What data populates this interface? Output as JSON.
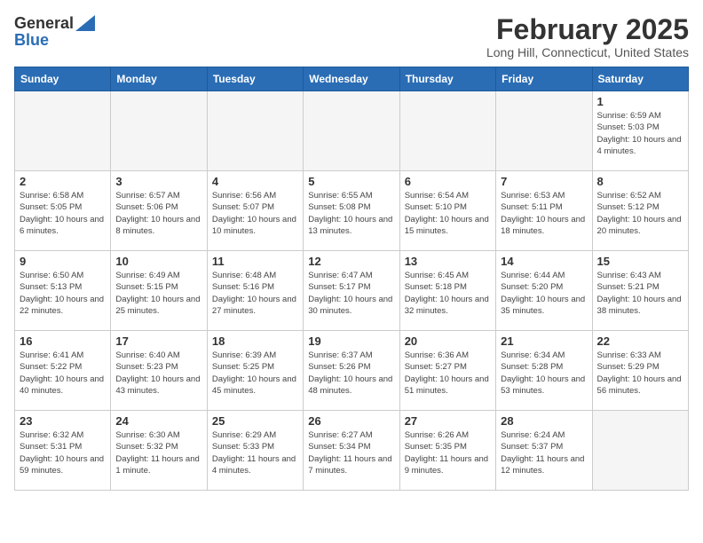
{
  "header": {
    "logo_general": "General",
    "logo_blue": "Blue",
    "title": "February 2025",
    "subtitle": "Long Hill, Connecticut, United States"
  },
  "days_of_week": [
    "Sunday",
    "Monday",
    "Tuesday",
    "Wednesday",
    "Thursday",
    "Friday",
    "Saturday"
  ],
  "weeks": [
    [
      {
        "day": "",
        "info": ""
      },
      {
        "day": "",
        "info": ""
      },
      {
        "day": "",
        "info": ""
      },
      {
        "day": "",
        "info": ""
      },
      {
        "day": "",
        "info": ""
      },
      {
        "day": "",
        "info": ""
      },
      {
        "day": "1",
        "info": "Sunrise: 6:59 AM\nSunset: 5:03 PM\nDaylight: 10 hours and 4 minutes."
      }
    ],
    [
      {
        "day": "2",
        "info": "Sunrise: 6:58 AM\nSunset: 5:05 PM\nDaylight: 10 hours and 6 minutes."
      },
      {
        "day": "3",
        "info": "Sunrise: 6:57 AM\nSunset: 5:06 PM\nDaylight: 10 hours and 8 minutes."
      },
      {
        "day": "4",
        "info": "Sunrise: 6:56 AM\nSunset: 5:07 PM\nDaylight: 10 hours and 10 minutes."
      },
      {
        "day": "5",
        "info": "Sunrise: 6:55 AM\nSunset: 5:08 PM\nDaylight: 10 hours and 13 minutes."
      },
      {
        "day": "6",
        "info": "Sunrise: 6:54 AM\nSunset: 5:10 PM\nDaylight: 10 hours and 15 minutes."
      },
      {
        "day": "7",
        "info": "Sunrise: 6:53 AM\nSunset: 5:11 PM\nDaylight: 10 hours and 18 minutes."
      },
      {
        "day": "8",
        "info": "Sunrise: 6:52 AM\nSunset: 5:12 PM\nDaylight: 10 hours and 20 minutes."
      }
    ],
    [
      {
        "day": "9",
        "info": "Sunrise: 6:50 AM\nSunset: 5:13 PM\nDaylight: 10 hours and 22 minutes."
      },
      {
        "day": "10",
        "info": "Sunrise: 6:49 AM\nSunset: 5:15 PM\nDaylight: 10 hours and 25 minutes."
      },
      {
        "day": "11",
        "info": "Sunrise: 6:48 AM\nSunset: 5:16 PM\nDaylight: 10 hours and 27 minutes."
      },
      {
        "day": "12",
        "info": "Sunrise: 6:47 AM\nSunset: 5:17 PM\nDaylight: 10 hours and 30 minutes."
      },
      {
        "day": "13",
        "info": "Sunrise: 6:45 AM\nSunset: 5:18 PM\nDaylight: 10 hours and 32 minutes."
      },
      {
        "day": "14",
        "info": "Sunrise: 6:44 AM\nSunset: 5:20 PM\nDaylight: 10 hours and 35 minutes."
      },
      {
        "day": "15",
        "info": "Sunrise: 6:43 AM\nSunset: 5:21 PM\nDaylight: 10 hours and 38 minutes."
      }
    ],
    [
      {
        "day": "16",
        "info": "Sunrise: 6:41 AM\nSunset: 5:22 PM\nDaylight: 10 hours and 40 minutes."
      },
      {
        "day": "17",
        "info": "Sunrise: 6:40 AM\nSunset: 5:23 PM\nDaylight: 10 hours and 43 minutes."
      },
      {
        "day": "18",
        "info": "Sunrise: 6:39 AM\nSunset: 5:25 PM\nDaylight: 10 hours and 45 minutes."
      },
      {
        "day": "19",
        "info": "Sunrise: 6:37 AM\nSunset: 5:26 PM\nDaylight: 10 hours and 48 minutes."
      },
      {
        "day": "20",
        "info": "Sunrise: 6:36 AM\nSunset: 5:27 PM\nDaylight: 10 hours and 51 minutes."
      },
      {
        "day": "21",
        "info": "Sunrise: 6:34 AM\nSunset: 5:28 PM\nDaylight: 10 hours and 53 minutes."
      },
      {
        "day": "22",
        "info": "Sunrise: 6:33 AM\nSunset: 5:29 PM\nDaylight: 10 hours and 56 minutes."
      }
    ],
    [
      {
        "day": "23",
        "info": "Sunrise: 6:32 AM\nSunset: 5:31 PM\nDaylight: 10 hours and 59 minutes."
      },
      {
        "day": "24",
        "info": "Sunrise: 6:30 AM\nSunset: 5:32 PM\nDaylight: 11 hours and 1 minute."
      },
      {
        "day": "25",
        "info": "Sunrise: 6:29 AM\nSunset: 5:33 PM\nDaylight: 11 hours and 4 minutes."
      },
      {
        "day": "26",
        "info": "Sunrise: 6:27 AM\nSunset: 5:34 PM\nDaylight: 11 hours and 7 minutes."
      },
      {
        "day": "27",
        "info": "Sunrise: 6:26 AM\nSunset: 5:35 PM\nDaylight: 11 hours and 9 minutes."
      },
      {
        "day": "28",
        "info": "Sunrise: 6:24 AM\nSunset: 5:37 PM\nDaylight: 11 hours and 12 minutes."
      },
      {
        "day": "",
        "info": ""
      }
    ]
  ]
}
